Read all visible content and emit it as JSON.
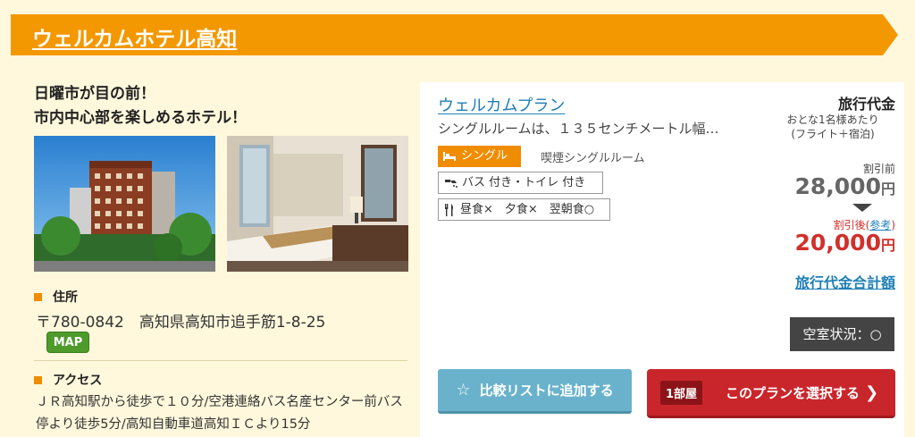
{
  "header": {
    "hotel_name": "ウェルカムホテル高知"
  },
  "catch_copy": {
    "line1": "日曜市が目の前！",
    "line2": "市内中心部を楽しめるホテル！"
  },
  "photos": [
    {
      "icon": "hotel-exterior-photo"
    },
    {
      "icon": "guest-room-photo"
    }
  ],
  "address": {
    "heading": "住所",
    "text": "〒780-0842　高知県高知市追手筋1-8-25",
    "map_label": "MAP"
  },
  "access": {
    "heading": "アクセス",
    "text": "ＪＲ高知駅から徒歩で１０分/空港連絡バス名産センター前バス停より徒歩5分/高知自動車道高知ＩＣより15分"
  },
  "plan": {
    "name": "ウェルカムプラン",
    "description": "シングルルームは、１３５センチメートル幅…",
    "room_type": "シングル",
    "smoking": "喫煙シングルルーム",
    "bath": "バス 付き・トイレ 付き",
    "meals": "昼食×　夕食×　翌朝食○"
  },
  "price": {
    "title": "旅行代金",
    "per_person": "おとな1名様あたり",
    "per_note": "(フライト＋宿泊)",
    "before_label": "割引前",
    "before_value": "28,000",
    "after_label_prefix": "割引後(",
    "after_label_ref": "参考",
    "after_label_suffix": ")",
    "after_value": "20,000",
    "yen": "円",
    "total_link": "旅行代金合計額"
  },
  "vacancy": "空室状況：○",
  "buttons": {
    "compare": "比較リストに追加する",
    "room_count": "1部屋",
    "select": "このプランを選択する",
    "chevron": "❯"
  },
  "colors": {
    "banner": "#f39800",
    "accent_orange": "#f08c00",
    "link_blue": "#1f7fb5",
    "sale_red": "#d0302c",
    "select_button": "#c9262b",
    "compare_button": "#6ab2cc"
  }
}
